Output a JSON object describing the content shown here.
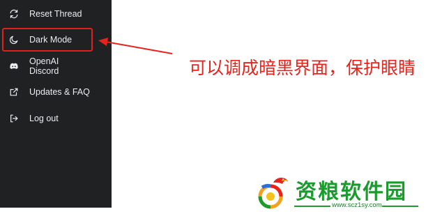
{
  "sidebar": {
    "items": [
      {
        "label": "Reset Thread",
        "icon": "refresh-icon"
      },
      {
        "label": "Dark Mode",
        "icon": "moon-icon"
      },
      {
        "label": "OpenAI Discord",
        "icon": "discord-icon"
      },
      {
        "label": "Updates & FAQ",
        "icon": "external-link-icon"
      },
      {
        "label": "Log out",
        "icon": "logout-icon"
      }
    ],
    "background": "#202123",
    "text_color": "#ececf1"
  },
  "annotation": {
    "text": "可以调成暗黑界面，保护眼睛",
    "color": "#e8231b"
  },
  "watermark": {
    "name": "资粮软件园",
    "url": "www.scz1sy.com",
    "color": "#1b9a2e"
  }
}
